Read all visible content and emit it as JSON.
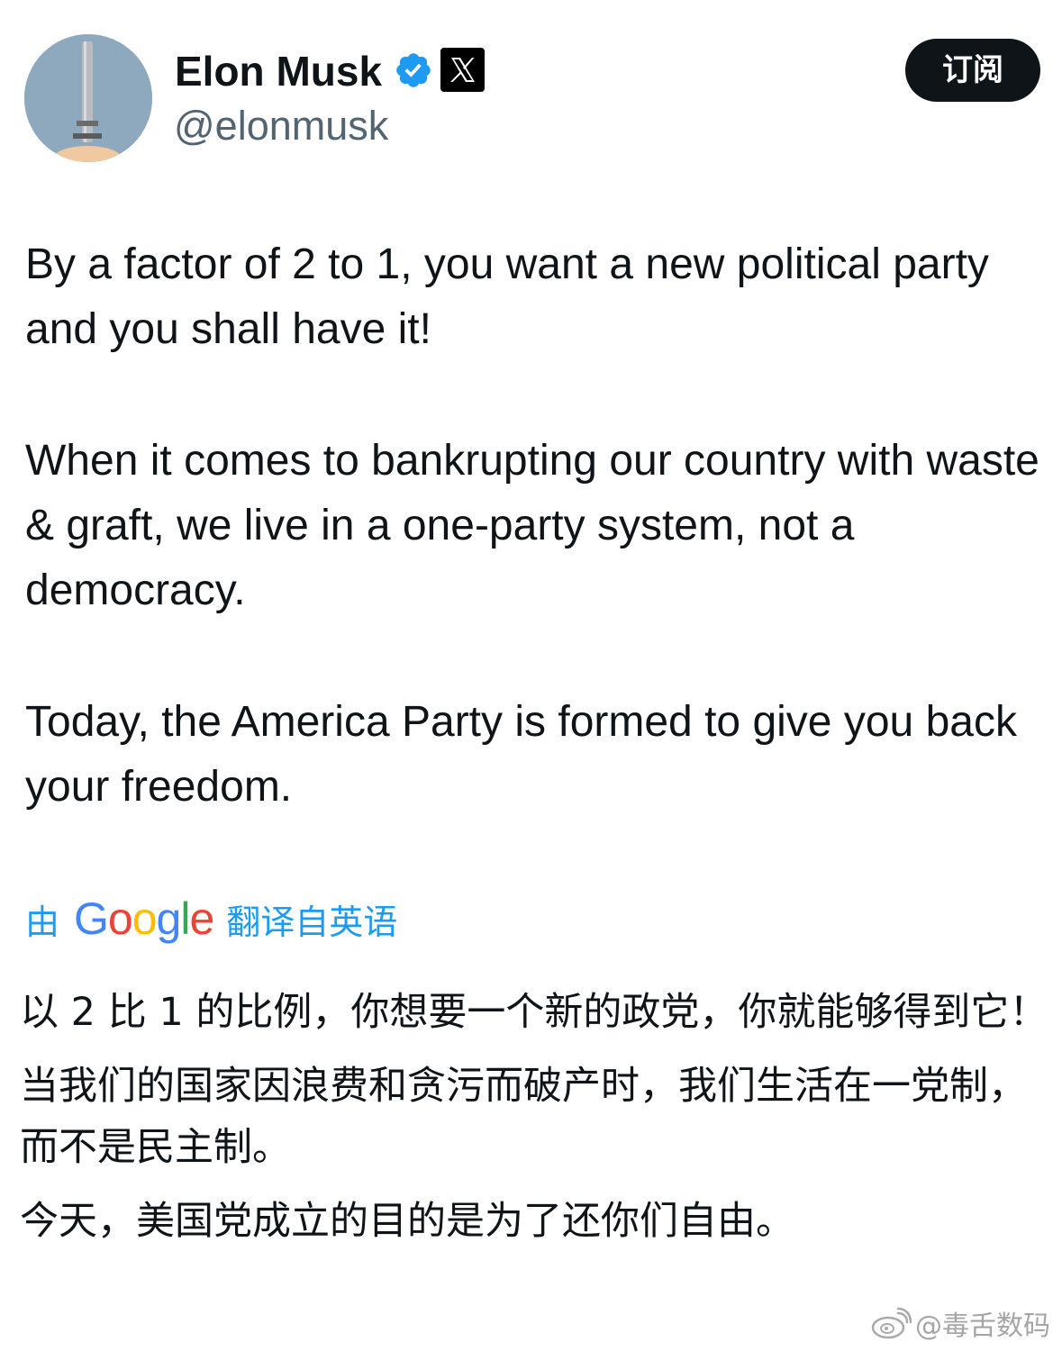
{
  "header": {
    "display_name": "Elon Musk",
    "handle": "@elonmusk",
    "subscribe_label": "订阅",
    "verified_icon": "verified-badge-icon",
    "affiliate_icon": "x-logo-icon",
    "accent_color": "#1d9bf0"
  },
  "tweet": {
    "paragraphs": [
      "By a factor of 2 to 1, you want a new political party and you shall have it!",
      "When it comes to bankrupting our country with waste & graft, we live in a one-party system, not a democracy.",
      "Today, the America Party is formed to give you back your freedom."
    ]
  },
  "translation": {
    "prefix": "由",
    "provider": "Google",
    "suffix": "翻译自英语",
    "paragraphs": [
      "以 2 比 1 的比例，你想要一个新的政党，你就能够得到它！",
      "当我们的国家因浪费和贪污而破产时，我们生活在一党制，而不是民主制。",
      "今天，美国党成立的目的是为了还你们自由。"
    ]
  },
  "watermark": {
    "text": "@毒舌数码",
    "icon": "weibo-logo-icon"
  }
}
